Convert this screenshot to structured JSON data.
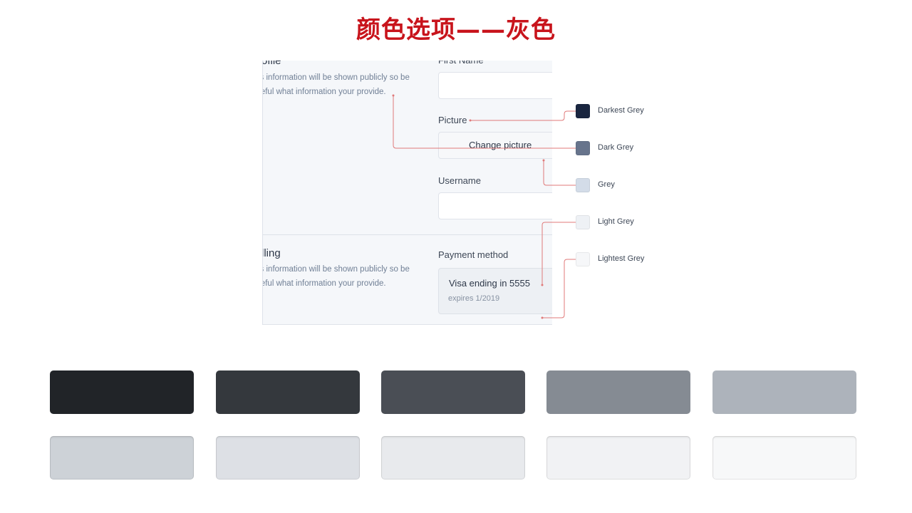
{
  "title": "颜色选项——灰色",
  "form": {
    "profile": {
      "title_fragment": "ofile",
      "desc_line1": "is information will be shown publicly so be",
      "desc_line2": "reful what information your provide."
    },
    "fields": {
      "first_name_label": "First Name",
      "picture_label": "Picture",
      "change_picture_label": "Change picture",
      "username_label": "Username"
    },
    "billing": {
      "title_fragment": "lling",
      "desc_line1": "is information will be shown publicly so be",
      "desc_line2": "reful what information your provide.",
      "payment_label": "Payment method",
      "card_line": "Visa ending in 5555",
      "card_expiry": "expires 1/2019"
    }
  },
  "legend": [
    {
      "name": "Darkest Grey",
      "color": "#1a2640"
    },
    {
      "name": "Dark Grey",
      "color": "#67748c"
    },
    {
      "name": "Grey",
      "color": "#d3dce8"
    },
    {
      "name": "Light Grey",
      "color": "#eef1f5"
    },
    {
      "name": "Lightest Grey",
      "color": "#f6f7f9"
    }
  ],
  "connector_color": "#e07a7a",
  "palette": {
    "row1": [
      "#212428",
      "#34383d",
      "#4a4e55",
      "#858b93",
      "#adb3bb"
    ],
    "row2": [
      "#cdd2d7",
      "#dde0e5",
      "#e8eaed",
      "#f1f2f4",
      "#f7f8f9"
    ]
  }
}
